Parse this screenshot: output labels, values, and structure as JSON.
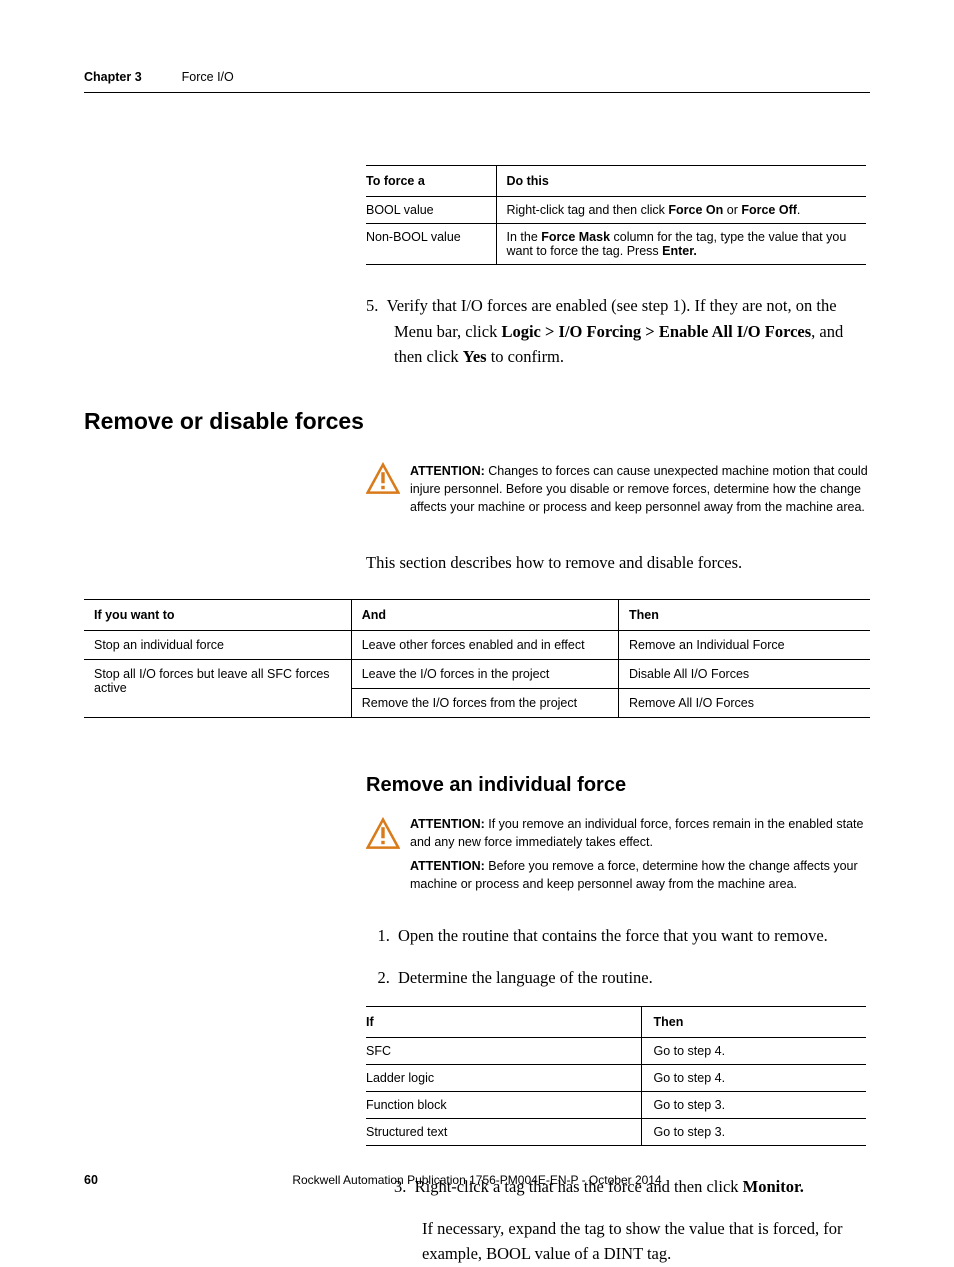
{
  "header": {
    "chapter_label": "Chapter 3",
    "chapter_title": "Force I/O"
  },
  "table1": {
    "head": {
      "c1": "To force a",
      "c2": "Do this"
    },
    "rows": [
      {
        "c1": "BOOL value",
        "c2_pre": "Right-click tag and then click ",
        "c2_b1": "Force On",
        "c2_mid": " or ",
        "c2_b2": "Force Off",
        "c2_post": "."
      },
      {
        "c1": "Non-BOOL value",
        "c2_pre": "In the ",
        "c2_b1": "Force Mask",
        "c2_mid": " column for the tag, type the value that you want to force the tag. Press ",
        "c2_b2": "Enter.",
        "c2_post": ""
      }
    ]
  },
  "step5": {
    "num": "5.",
    "pre": "Verify that I/O forces are enabled (see step 1). If they are not, on the Menu bar, click ",
    "bold": "Logic > I/O Forcing > Enable All I/O Forces",
    "mid": ", and then click ",
    "bold2": "Yes",
    "post": " to confirm."
  },
  "section": {
    "title": "Remove or disable forces",
    "attention_label": "ATTENTION:",
    "attention_text": "Changes to forces can cause unexpected machine motion that could injure personnel. Before you disable or remove forces, determine how the change affects your machine or process and keep personnel away from the machine area.",
    "intro": "This section describes how to remove and disable forces."
  },
  "table2": {
    "head": {
      "c1": "If you want to",
      "c2": "And",
      "c3": "Then"
    },
    "rows": {
      "r1c1": "Stop an individual force",
      "r1c2": "Leave other forces enabled and in effect",
      "r1c3": "Remove an Individual Force",
      "r2c1": "Stop all I/O forces but leave all SFC forces active",
      "r2c2": "Leave the I/O forces in the project",
      "r2c3": "Disable All I/O Forces",
      "r3c2": "Remove the I/O forces from the project",
      "r3c3": "Remove All I/O Forces"
    }
  },
  "subsection": {
    "title": "Remove an individual force",
    "att1_label": "ATTENTION:",
    "att1_text": "If you remove an individual force, forces remain in the enabled state and any new force immediately takes effect.",
    "att2_label": "ATTENTION:",
    "att2_text": "Before you remove a force, determine how the change affects your machine or process and keep personnel away from the machine area.",
    "step1": "Open the routine that contains the force that you want to remove.",
    "step2": "Determine the language of the routine."
  },
  "table3": {
    "head": {
      "c1": "If",
      "c2": "Then"
    },
    "rows": [
      {
        "c1": "SFC",
        "c2": "Go to step 4."
      },
      {
        "c1": "Ladder logic",
        "c2": "Go to step 4."
      },
      {
        "c1": "Function block",
        "c2": "Go to step 3."
      },
      {
        "c1": "Structured text",
        "c2": "Go to step 3."
      }
    ]
  },
  "step3": {
    "num": "3.",
    "pre": "Right-click a tag that has the force and then click ",
    "bold": "Monitor.",
    "follow": "If necessary, expand the tag to show the value that is forced, for example, BOOL value of a DINT tag."
  },
  "footer": {
    "page_num": "60",
    "center": "Rockwell Automation Publication 1756-PM004E-EN-P - October 2014"
  }
}
